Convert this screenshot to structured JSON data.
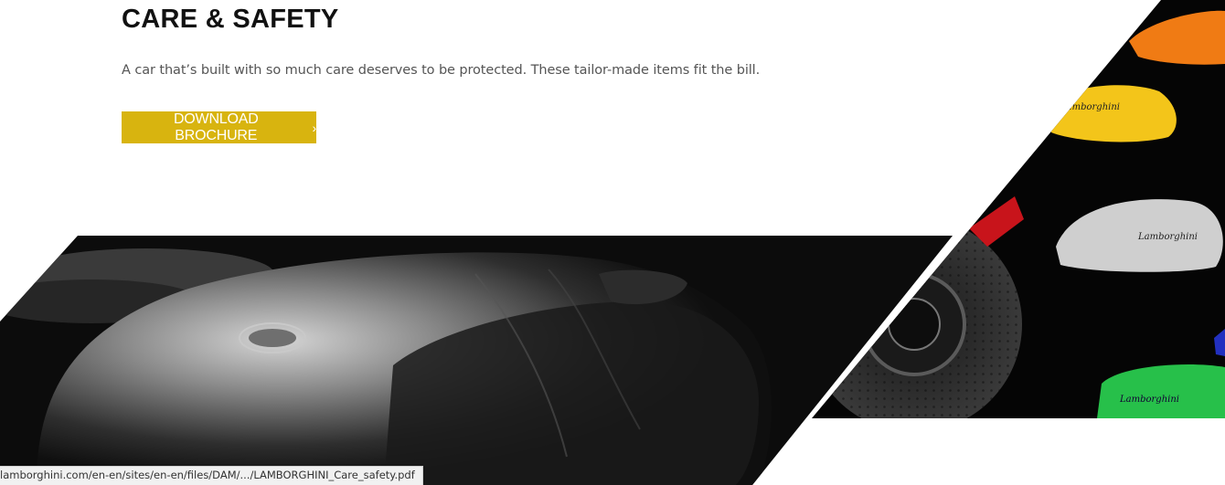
{
  "section": {
    "title": "CARE & SAFETY",
    "description": "A car that’s built with so much care deserves to be protected. These tailor-made items fit the bill.",
    "button_label": "DOWNLOAD BROCHURE",
    "button_icon": "chevron-right-icon",
    "button_color": "#d8b40f"
  },
  "images": {
    "car_cover_image": "covered-car-photo",
    "brakes_image": "brake-calipers-photo",
    "caliper_brand_text": [
      "Lamborghini",
      "Lamborghini",
      "Lamborghini"
    ]
  },
  "status_bar": {
    "url": "lamborghini.com/en-en/sites/en-en/files/DAM/.../LAMBORGHINI_Care_safety.pdf"
  }
}
